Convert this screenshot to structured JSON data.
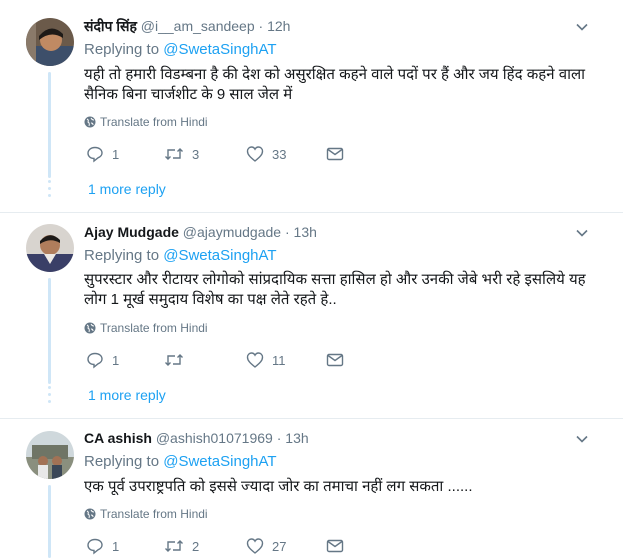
{
  "tweets": [
    {
      "name": "संदीप सिंह",
      "handle": "@i__am_sandeep",
      "dot": "·",
      "time": "12h",
      "replying_prefix": "Replying to",
      "replying_to": "@SwetaSinghAT",
      "text": "यही तो हमारी विडम्बना है की देश को असुरक्षित कहने वाले पदों पर हैं और जय हिंद कहने वाला सैनिक बिना चार्जशीट के 9 साल जेल में",
      "translate": "Translate from Hindi",
      "replies": "1",
      "retweets": "3",
      "likes": "33",
      "more_reply": "1 more reply"
    },
    {
      "name": "Ajay Mudgade",
      "handle": "@ajaymudgade",
      "dot": "·",
      "time": "13h",
      "replying_prefix": "Replying to",
      "replying_to": "@SwetaSinghAT",
      "text": "सुपरस्टार और रीटायर लोगोको सांप्रदायिक सत्ता हासिल हो और उनकी जेबे भरी रहे इसलिये यह लोग 1 मूर्ख समुदाय विशेष का पक्ष लेते रहते हे..",
      "translate": "Translate from Hindi",
      "replies": "1",
      "retweets": "",
      "likes": "11",
      "more_reply": "1 more reply"
    },
    {
      "name": "CA ashish",
      "handle": "@ashish01071969",
      "dot": "·",
      "time": "13h",
      "replying_prefix": "Replying to",
      "replying_to": "@SwetaSinghAT",
      "text": "एक पूर्व उपराष्ट्रपति को इससे ज्यादा जोर का तमाचा नहीं लग सकता ......",
      "translate": "Translate from Hindi",
      "replies": "1",
      "retweets": "2",
      "likes": "27"
    }
  ],
  "colors": {
    "link": "#1da1f2",
    "muted": "#657786",
    "text": "#14171a",
    "thread": "#cfe6f7",
    "divider": "#e6ecf0"
  },
  "icons": [
    "reply-icon",
    "retweet-icon",
    "like-icon",
    "message-icon",
    "globe-icon",
    "caret-down-icon"
  ]
}
